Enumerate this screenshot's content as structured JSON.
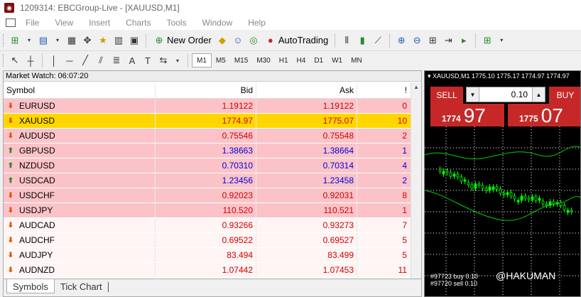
{
  "window": {
    "title": "1209314: EBCGroup-Live - [XAUUSD,M1]"
  },
  "menu": [
    "File",
    "View",
    "Insert",
    "Charts",
    "Tools",
    "Window",
    "Help"
  ],
  "toolbar": {
    "new_order": "New Order",
    "autotrading": "AutoTrading",
    "timeframes": [
      "M1",
      "M5",
      "M15",
      "M30",
      "H1",
      "H4",
      "D1",
      "W1",
      "MN"
    ],
    "active_timeframe": "M1",
    "text_tool": "A"
  },
  "market_watch": {
    "title": "Market Watch: 06:07:20",
    "columns": [
      "Symbol",
      "Bid",
      "Ask",
      "!"
    ],
    "rows": [
      {
        "symbol": "EURUSD",
        "bid": "1.19122",
        "ask": "1.19122",
        "spread": "0",
        "dir": "down",
        "bg": "#fbc3c8",
        "color": "#d10000"
      },
      {
        "symbol": "XAUUSD",
        "bid": "1774.97",
        "ask": "1775.07",
        "spread": "10",
        "dir": "down",
        "bg": "#ffd700",
        "color": "#d10000"
      },
      {
        "symbol": "AUDUSD",
        "bid": "0.75546",
        "ask": "0.75548",
        "spread": "2",
        "dir": "down",
        "bg": "#fbc3c8",
        "color": "#d10000"
      },
      {
        "symbol": "GBPUSD",
        "bid": "1.38663",
        "ask": "1.38664",
        "spread": "1",
        "dir": "up",
        "bg": "#fbc3c8",
        "color": "#0000e0"
      },
      {
        "symbol": "NZDUSD",
        "bid": "0.70310",
        "ask": "0.70314",
        "spread": "4",
        "dir": "up",
        "bg": "#fbc3c8",
        "color": "#0000e0"
      },
      {
        "symbol": "USDCAD",
        "bid": "1.23456",
        "ask": "1.23458",
        "spread": "2",
        "dir": "up",
        "bg": "#fbc3c8",
        "color": "#0000e0"
      },
      {
        "symbol": "USDCHF",
        "bid": "0.92023",
        "ask": "0.92031",
        "spread": "8",
        "dir": "down",
        "bg": "#fbc3c8",
        "color": "#d10000"
      },
      {
        "symbol": "USDJPY",
        "bid": "110.520",
        "ask": "110.521",
        "spread": "1",
        "dir": "down",
        "bg": "#fbc3c8",
        "color": "#d10000"
      },
      {
        "symbol": "AUDCAD",
        "bid": "0.93266",
        "ask": "0.93273",
        "spread": "7",
        "dir": "down",
        "bg": "#fff5f5",
        "color": "#d10000"
      },
      {
        "symbol": "AUDCHF",
        "bid": "0.69522",
        "ask": "0.69527",
        "spread": "5",
        "dir": "down",
        "bg": "#fff5f5",
        "color": "#d10000"
      },
      {
        "symbol": "AUDJPY",
        "bid": "83.494",
        "ask": "83.499",
        "spread": "5",
        "dir": "down",
        "bg": "#fff5f5",
        "color": "#d10000"
      },
      {
        "symbol": "AUDNZD",
        "bid": "1.07442",
        "ask": "1.07453",
        "spread": "11",
        "dir": "down",
        "bg": "#fff5f5",
        "color": "#d10000"
      }
    ],
    "tabs": [
      "Symbols",
      "Tick Chart"
    ],
    "active_tab": "Symbols"
  },
  "chart": {
    "title": "XAUUSD,M1  1775.10 1775.17 1774.97 1774.97",
    "sell_label": "SELL",
    "buy_label": "BUY",
    "lot": "0.10",
    "sell_price_small": "1774",
    "sell_price_big": "97",
    "buy_price_small": "1775",
    "buy_price_big": "07",
    "orders": [
      "#97723 buy 0.10",
      "#97720 sell 0.10"
    ],
    "watermark": "@HAKUMAN",
    "colors": {
      "bg": "#000000",
      "candles": "#00ff00",
      "grid": "#ffffff"
    }
  }
}
